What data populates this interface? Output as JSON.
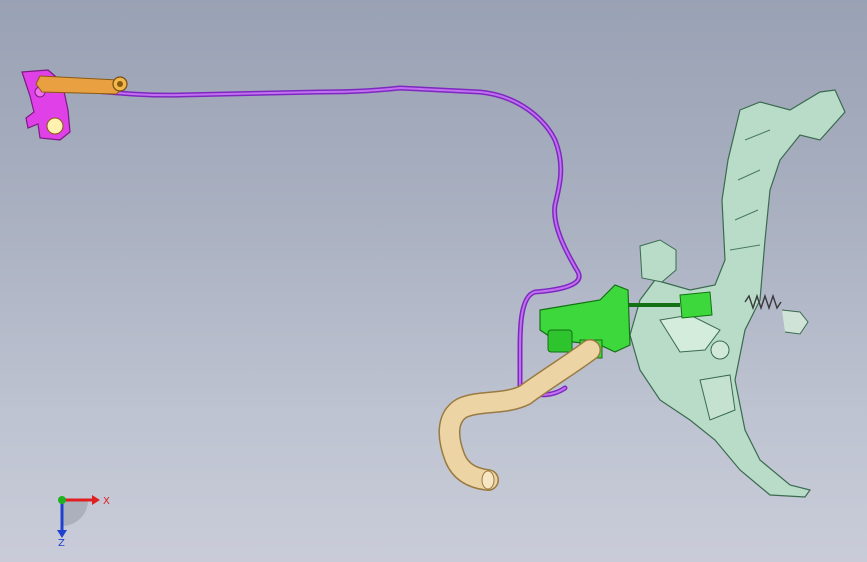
{
  "viewport": {
    "background_top": "#99a1b4",
    "background_bottom": "#c9ccd8"
  },
  "parts": {
    "lever_bracket_color": "#e040e8",
    "clutch_line_color": "#9a3bd6",
    "rod_color": "#e0a040",
    "master_cylinder_color": "#3cd83c",
    "pedal_assembly_color": "#b8dcc8",
    "hose_color": "#e8d0a0"
  },
  "triad": {
    "x_label": "X",
    "z_label": "Z",
    "x_color": "#e02020",
    "y_color": "#20b020",
    "z_color": "#2040d0"
  }
}
